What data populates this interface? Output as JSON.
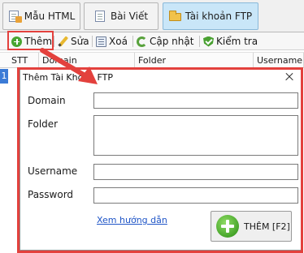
{
  "tabs": [
    {
      "label": "Mẫu HTML",
      "icon": "html-template-icon"
    },
    {
      "label": "Bài Viết",
      "icon": "article-icon"
    },
    {
      "label": "Tài khoản FTP",
      "icon": "ftp-folder-icon",
      "active": true
    }
  ],
  "toolbar": {
    "add_label": "Thêm",
    "edit_label": "Sửa",
    "delete_label": "Xoá",
    "update_label": "Cập nhật",
    "check_label": "Kiểm tra"
  },
  "grid": {
    "columns": [
      "STT",
      "Domain",
      "Folder",
      "Username"
    ],
    "first_row_marker": "1"
  },
  "dialog": {
    "title": "Thêm Tài Khoản FTP",
    "fields": {
      "domain_label": "Domain",
      "domain_value": "",
      "folder_label": "Folder",
      "folder_value": "",
      "username_label": "Username",
      "username_value": "",
      "password_label": "Password",
      "password_value": ""
    },
    "guide_link": "Xem hướng dẫn",
    "submit_label": "THÊM [F2]"
  },
  "colors": {
    "highlight": "#e3413d",
    "active_tab": "#c9e6f8",
    "link": "#1f55c7"
  }
}
